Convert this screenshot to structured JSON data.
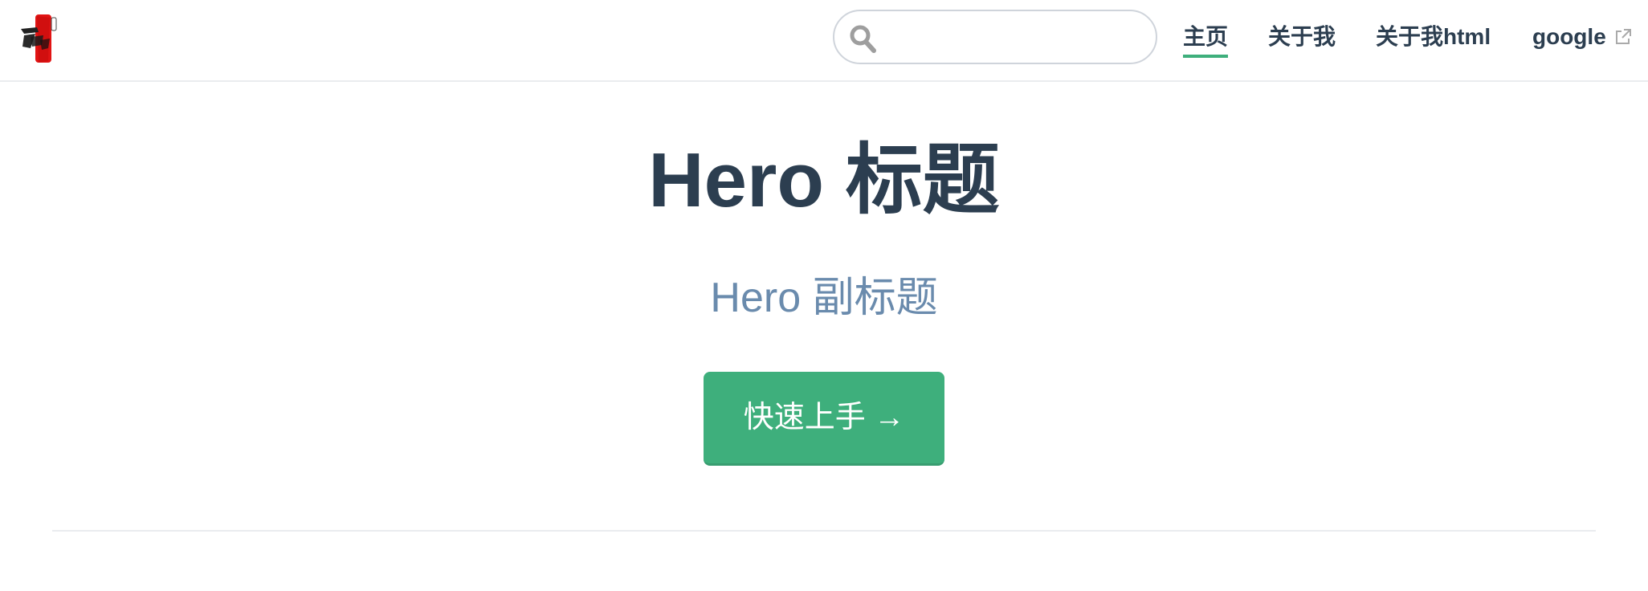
{
  "navbar": {
    "logo_icon": "brush-seal-logo-icon",
    "search": {
      "placeholder": "",
      "value": "",
      "icon": "search-icon"
    },
    "links": [
      {
        "label": "主页",
        "active": true
      },
      {
        "label": "关于我",
        "active": false
      },
      {
        "label": "关于我html",
        "active": false
      },
      {
        "label": "google",
        "external": true,
        "icon": "external-link-icon"
      }
    ]
  },
  "hero": {
    "title": "Hero 标题",
    "subtitle": "Hero 副标题",
    "action_label": "快速上手 →"
  },
  "colors": {
    "accent": "#3eaf7c",
    "text": "#2c3e50",
    "subtitle": "#6a8bad",
    "border": "#eaecef"
  }
}
